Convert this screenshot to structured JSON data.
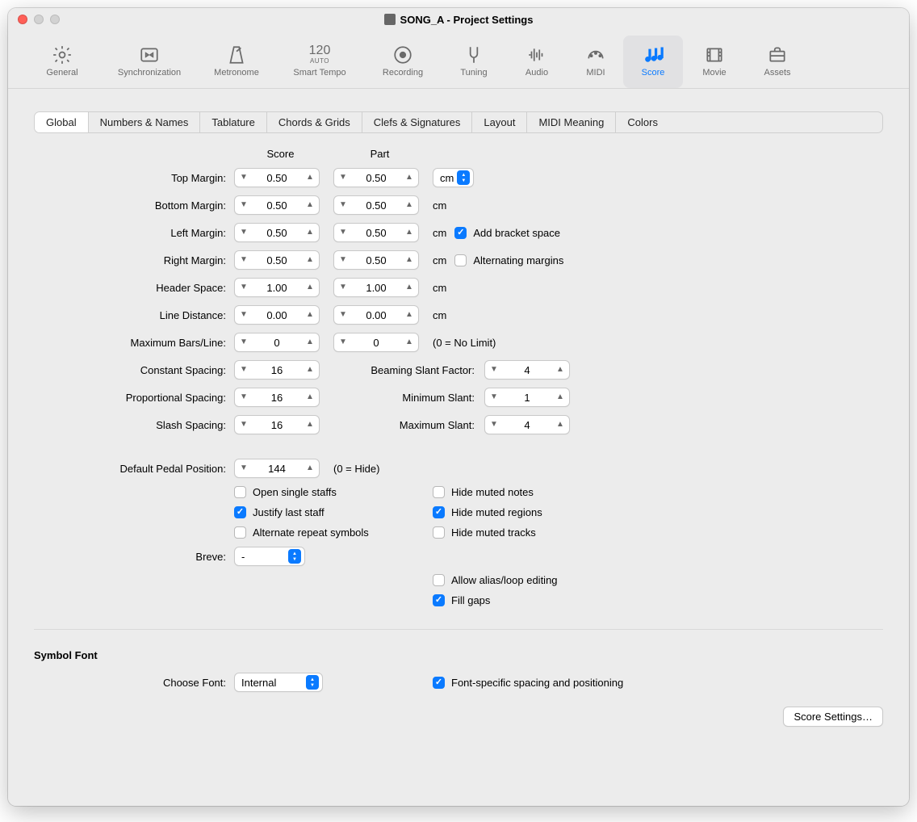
{
  "window": {
    "title": "SONG_A - Project Settings"
  },
  "toolbar": [
    {
      "id": "general",
      "label": "General"
    },
    {
      "id": "sync",
      "label": "Synchronization"
    },
    {
      "id": "metronome",
      "label": "Metronome"
    },
    {
      "id": "smarttempo",
      "label": "Smart Tempo",
      "top": "120",
      "sub": "AUTO"
    },
    {
      "id": "recording",
      "label": "Recording"
    },
    {
      "id": "tuning",
      "label": "Tuning"
    },
    {
      "id": "audio",
      "label": "Audio"
    },
    {
      "id": "midi",
      "label": "MIDI"
    },
    {
      "id": "score",
      "label": "Score",
      "active": true
    },
    {
      "id": "movie",
      "label": "Movie"
    },
    {
      "id": "assets",
      "label": "Assets"
    }
  ],
  "tabs": [
    "Global",
    "Numbers & Names",
    "Tablature",
    "Chords & Grids",
    "Clefs & Signatures",
    "Layout",
    "MIDI Meaning",
    "Colors"
  ],
  "tabs_active": 0,
  "columns": {
    "score": "Score",
    "part": "Part"
  },
  "rows": {
    "top_margin": {
      "label": "Top Margin:",
      "score": "0.50",
      "part": "0.50",
      "unit": "cm"
    },
    "bottom_margin": {
      "label": "Bottom Margin:",
      "score": "0.50",
      "part": "0.50",
      "unit": "cm"
    },
    "left_margin": {
      "label": "Left Margin:",
      "score": "0.50",
      "part": "0.50",
      "unit": "cm"
    },
    "right_margin": {
      "label": "Right Margin:",
      "score": "0.50",
      "part": "0.50",
      "unit": "cm"
    },
    "header_space": {
      "label": "Header Space:",
      "score": "1.00",
      "part": "1.00",
      "unit": "cm"
    },
    "line_distance": {
      "label": "Line Distance:",
      "score": "0.00",
      "part": "0.00",
      "unit": "cm"
    },
    "max_bars": {
      "label": "Maximum Bars/Line:",
      "score": "0",
      "part": "0",
      "note": "(0 = No Limit)"
    },
    "constant_spacing": {
      "label": "Constant Spacing:",
      "val": "16"
    },
    "proportional_spacing": {
      "label": "Proportional Spacing:",
      "val": "16"
    },
    "slash_spacing": {
      "label": "Slash Spacing:",
      "val": "16"
    },
    "beaming_slant": {
      "label": "Beaming Slant Factor:",
      "val": "4"
    },
    "min_slant": {
      "label": "Minimum Slant:",
      "val": "1"
    },
    "max_slant": {
      "label": "Maximum Slant:",
      "val": "4"
    },
    "pedal": {
      "label": "Default Pedal Position:",
      "val": "144",
      "note": "(0 = Hide)"
    }
  },
  "checks": {
    "add_bracket": {
      "label": "Add bracket space",
      "checked": true
    },
    "alt_margins": {
      "label": "Alternating margins",
      "checked": false
    },
    "open_single": {
      "label": "Open single staffs",
      "checked": false
    },
    "justify_last": {
      "label": "Justify last staff",
      "checked": true
    },
    "alt_repeat": {
      "label": "Alternate repeat symbols",
      "checked": false
    },
    "hide_muted_notes": {
      "label": "Hide muted notes",
      "checked": false
    },
    "hide_muted_regions": {
      "label": "Hide muted regions",
      "checked": true
    },
    "hide_muted_tracks": {
      "label": "Hide muted tracks",
      "checked": false
    },
    "allow_alias": {
      "label": "Allow alias/loop editing",
      "checked": false
    },
    "fill_gaps": {
      "label": "Fill gaps",
      "checked": true
    },
    "font_specific": {
      "label": "Font-specific spacing and positioning",
      "checked": true
    }
  },
  "breve": {
    "label": "Breve:",
    "value": "-"
  },
  "symbol_font": {
    "title": "Symbol Font",
    "choose_label": "Choose Font:",
    "value": "Internal"
  },
  "buttons": {
    "score_settings": "Score Settings…"
  }
}
